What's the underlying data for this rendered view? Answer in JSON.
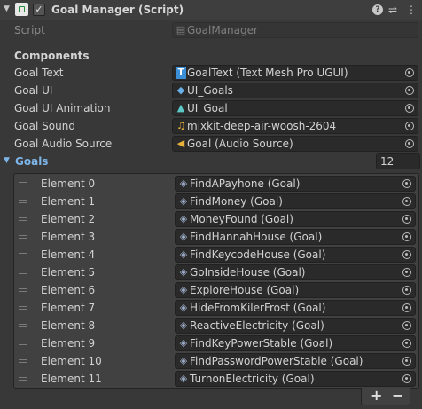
{
  "component": {
    "title": "Goal Manager (Script)",
    "enabled_mark": "✓"
  },
  "script": {
    "label": "Script",
    "value": "GoalManager"
  },
  "section_title": "Components",
  "fields": [
    {
      "label": "Goal Text",
      "value": "GoalText (Text Mesh Pro UGUI)",
      "icon": "text-icon"
    },
    {
      "label": "Goal UI",
      "value": "UI_Goals",
      "icon": "cube-icon"
    },
    {
      "label": "Goal UI Animation",
      "value": "UI_Goal",
      "icon": "animation-icon"
    },
    {
      "label": "Goal Sound",
      "value": "mixkit-deep-air-woosh-2604",
      "icon": "audio-clip-icon"
    },
    {
      "label": "Goal Audio Source",
      "value": "Goal (Audio Source)",
      "icon": "speaker-icon"
    }
  ],
  "goals": {
    "label": "Goals",
    "count": "12",
    "elements": [
      {
        "label": "Element 0",
        "value": "FindAPayhone (Goal)"
      },
      {
        "label": "Element 1",
        "value": "FindMoney (Goal)"
      },
      {
        "label": "Element 2",
        "value": "MoneyFound (Goal)"
      },
      {
        "label": "Element 3",
        "value": "FindHannahHouse (Goal)"
      },
      {
        "label": "Element 4",
        "value": "FindKeycodeHouse (Goal)"
      },
      {
        "label": "Element 5",
        "value": "GoInsideHouse (Goal)"
      },
      {
        "label": "Element 6",
        "value": "ExploreHouse (Goal)"
      },
      {
        "label": "Element 7",
        "value": "HideFromKilerFrost (Goal)"
      },
      {
        "label": "Element 8",
        "value": "ReactiveElectricity (Goal)"
      },
      {
        "label": "Element 9",
        "value": "FindKeyPowerStable (Goal)"
      },
      {
        "label": "Element 10",
        "value": "FindPasswordPowerStable (Goal)"
      },
      {
        "label": "Element 11",
        "value": "TurnonElectricity (Goal)"
      }
    ]
  },
  "buttons": {
    "add": "+",
    "remove": "−"
  },
  "colors": {
    "accent": "#7eb5e8",
    "background": "#383838",
    "field": "#2a2a2a"
  }
}
